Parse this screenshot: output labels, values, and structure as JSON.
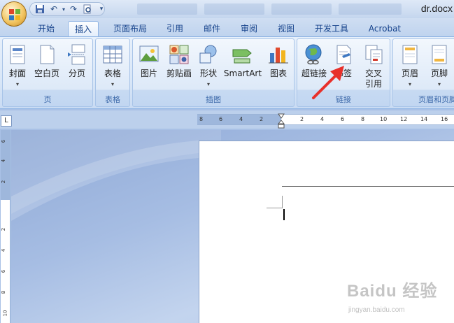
{
  "document_title": "dr.docx",
  "quick_access": {
    "save_icon": "save-icon",
    "undo_icon": "undo-icon",
    "redo_icon": "redo-icon",
    "print_preview_icon": "print-preview-icon",
    "customize_icon": "customize-qat-icon"
  },
  "tabs": [
    {
      "label": "开始",
      "active": false
    },
    {
      "label": "插入",
      "active": true
    },
    {
      "label": "页面布局",
      "active": false
    },
    {
      "label": "引用",
      "active": false
    },
    {
      "label": "邮件",
      "active": false
    },
    {
      "label": "审阅",
      "active": false
    },
    {
      "label": "视图",
      "active": false
    },
    {
      "label": "开发工具",
      "active": false
    },
    {
      "label": "Acrobat",
      "active": false
    }
  ],
  "ribbon": {
    "groups": [
      {
        "label": "页",
        "buttons": [
          {
            "label": "封面",
            "icon": "cover-page-icon",
            "dropdown": true
          },
          {
            "label": "空白页",
            "icon": "blank-page-icon",
            "dropdown": false
          },
          {
            "label": "分页",
            "icon": "page-break-icon",
            "dropdown": false
          }
        ]
      },
      {
        "label": "表格",
        "buttons": [
          {
            "label": "表格",
            "icon": "table-icon",
            "dropdown": true
          }
        ]
      },
      {
        "label": "插图",
        "buttons": [
          {
            "label": "图片",
            "icon": "picture-icon",
            "dropdown": false
          },
          {
            "label": "剪贴画",
            "icon": "clip-art-icon",
            "dropdown": false
          },
          {
            "label": "形状",
            "icon": "shapes-icon",
            "dropdown": true
          },
          {
            "label": "SmartArt",
            "icon": "smartart-icon",
            "dropdown": false
          },
          {
            "label": "图表",
            "icon": "chart-icon",
            "dropdown": false
          }
        ]
      },
      {
        "label": "链接",
        "buttons": [
          {
            "label": "超链接",
            "icon": "hyperlink-icon",
            "dropdown": false
          },
          {
            "label": "书签",
            "icon": "bookmark-icon",
            "dropdown": false
          },
          {
            "label": "交叉",
            "label_line2": "引用",
            "icon": "cross-reference-icon",
            "dropdown": false
          }
        ]
      },
      {
        "label": "页眉和页脚",
        "buttons": [
          {
            "label": "页眉",
            "icon": "header-icon",
            "dropdown": true
          },
          {
            "label": "页脚",
            "icon": "footer-icon",
            "dropdown": true
          }
        ]
      }
    ]
  },
  "ruler": {
    "tab_selector": "L",
    "horizontal_ticks": [
      "8",
      "6",
      "4",
      "2",
      "2",
      "4",
      "6",
      "8",
      "10",
      "12",
      "14",
      "16"
    ],
    "vertical_ticks": [
      "6",
      "4",
      "2",
      "2",
      "4",
      "6",
      "8",
      "10"
    ]
  },
  "annotation": {
    "arrow_color": "#e8302a"
  },
  "watermark": {
    "text": "Baidu 经验",
    "url": "jingyan.baidu.com"
  }
}
